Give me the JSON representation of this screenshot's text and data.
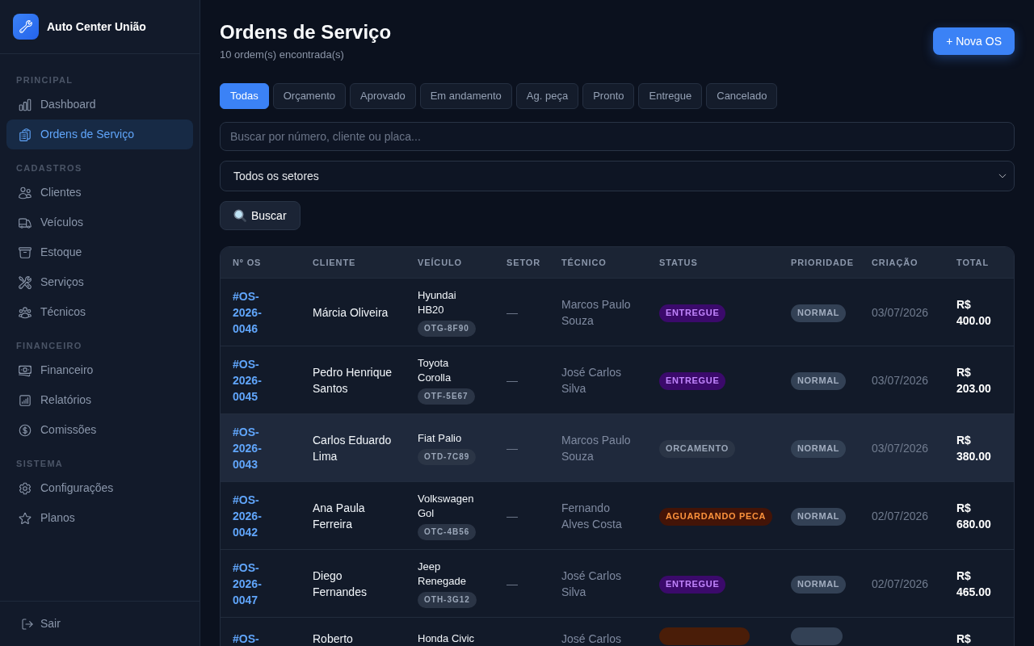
{
  "sidebar": {
    "brand": "Auto Center União",
    "sections": [
      {
        "title": "PRINCIPAL",
        "items": [
          {
            "label": "Dashboard",
            "selected": false
          },
          {
            "label": "Ordens de Serviço",
            "selected": true
          }
        ]
      },
      {
        "title": "CADASTROS",
        "items": [
          {
            "label": "Clientes",
            "selected": false
          },
          {
            "label": "Veículos",
            "selected": false
          },
          {
            "label": "Estoque",
            "selected": false
          },
          {
            "label": "Serviços",
            "selected": false
          },
          {
            "label": "Técnicos",
            "selected": false
          }
        ]
      },
      {
        "title": "FINANCEIRO",
        "items": [
          {
            "label": "Financeiro",
            "selected": false
          },
          {
            "label": "Relatórios",
            "selected": false
          },
          {
            "label": "Comissões",
            "selected": false
          }
        ]
      },
      {
        "title": "SISTEMA",
        "items": [
          {
            "label": "Configurações",
            "selected": false
          },
          {
            "label": "Planos",
            "selected": false
          }
        ]
      }
    ],
    "logout": "Sair"
  },
  "header": {
    "title": "Ordens de Serviço",
    "subtitle": "10 ordem(s) encontrada(s)",
    "new_button": "+ Nova OS"
  },
  "filters": [
    {
      "label": "Todas",
      "selected": true
    },
    {
      "label": "Orçamento",
      "selected": false
    },
    {
      "label": "Aprovado",
      "selected": false
    },
    {
      "label": "Em andamento",
      "selected": false
    },
    {
      "label": "Ag. peça",
      "selected": false
    },
    {
      "label": "Pronto",
      "selected": false
    },
    {
      "label": "Entregue",
      "selected": false
    },
    {
      "label": "Cancelado",
      "selected": false
    }
  ],
  "search": {
    "placeholder": "Buscar por número, cliente ou placa..."
  },
  "sector_select": {
    "value": "Todos os setores"
  },
  "search_button": {
    "label": "Buscar"
  },
  "table": {
    "columns": [
      "Nº OS",
      "CLIENTE",
      "VEÍCULO",
      "SETOR",
      "TÉCNICO",
      "STATUS",
      "PRIORIDADE",
      "CRIAÇÃO",
      "TOTAL"
    ],
    "rows": [
      {
        "number": "#OS-2026-0046",
        "client": "Márcia Oliveira",
        "vehicle": "Hyundai HB20",
        "plate": "OTG-8F90",
        "sector": "—",
        "technician": "Marcos Paulo Souza",
        "status": {
          "label": "ENTREGUE",
          "kind": "delivered"
        },
        "priority": {
          "label": "NORMAL",
          "kind": "normal"
        },
        "created": "03/07/2026",
        "total": "R$ 400.00",
        "hovered": false
      },
      {
        "number": "#OS-2026-0045",
        "client": "Pedro Henrique Santos",
        "vehicle": "Toyota Corolla",
        "plate": "OTF-5E67",
        "sector": "—",
        "technician": "José Carlos Silva",
        "status": {
          "label": "ENTREGUE",
          "kind": "delivered"
        },
        "priority": {
          "label": "NORMAL",
          "kind": "normal"
        },
        "created": "03/07/2026",
        "total": "R$ 203.00",
        "hovered": false
      },
      {
        "number": "#OS-2026-0043",
        "client": "Carlos Eduardo Lima",
        "vehicle": "Fiat Palio",
        "plate": "OTD-7C89",
        "sector": "—",
        "technician": "Marcos Paulo Souza",
        "status": {
          "label": "ORCAMENTO",
          "kind": "quote"
        },
        "priority": {
          "label": "NORMAL",
          "kind": "normal"
        },
        "created": "03/07/2026",
        "total": "R$ 380.00",
        "hovered": true
      },
      {
        "number": "#OS-2026-0042",
        "client": "Ana Paula Ferreira",
        "vehicle": "Volkswagen Gol",
        "plate": "OTC-4B56",
        "sector": "—",
        "technician": "Fernando Alves Costa",
        "status": {
          "label": "AGUARDANDO PECA",
          "kind": "waiting"
        },
        "priority": {
          "label": "NORMAL",
          "kind": "normal"
        },
        "created": "02/07/2026",
        "total": "R$ 680.00",
        "hovered": false
      },
      {
        "number": "#OS-2026-0047",
        "client": "Diego Fernandes",
        "vehicle": "Jeep Renegade",
        "plate": "OTH-3G12",
        "sector": "—",
        "technician": "José Carlos Silva",
        "status": {
          "label": "ENTREGUE",
          "kind": "delivered"
        },
        "priority": {
          "label": "NORMAL",
          "kind": "normal"
        },
        "created": "02/07/2026",
        "total": "R$ 465.00",
        "hovered": false
      },
      {
        "number": "#OS-",
        "client": "Roberto",
        "vehicle": "Honda Civic",
        "technician": "José Carlos",
        "status": {
          "kind": "progress"
        },
        "priority": {
          "kind": "normal"
        },
        "total": "R$",
        "hovered": false
      }
    ]
  }
}
